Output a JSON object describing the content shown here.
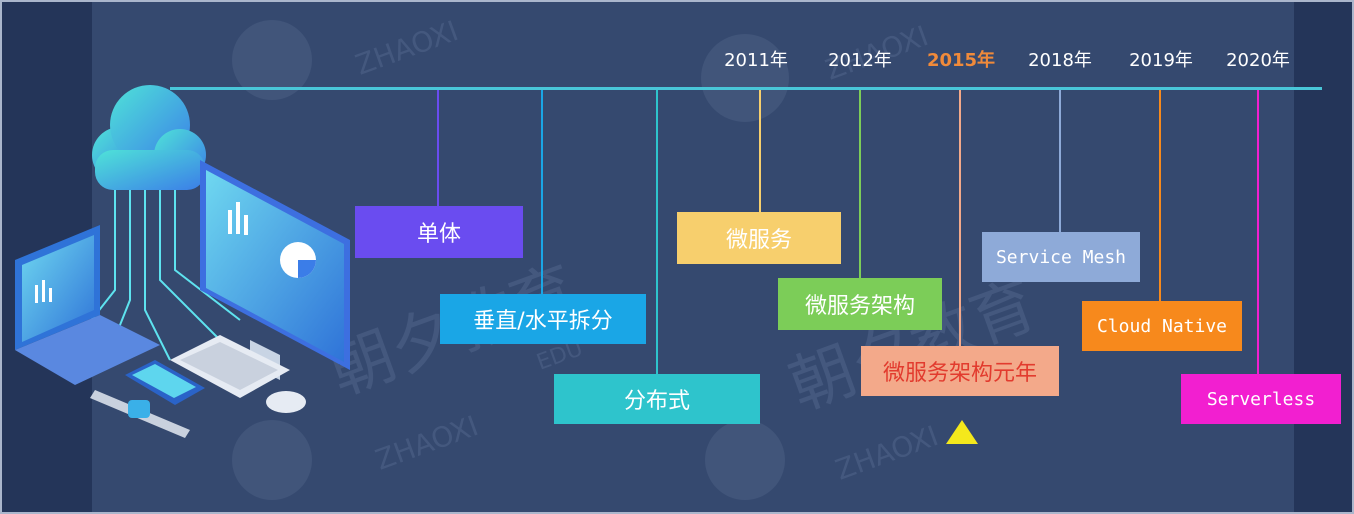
{
  "watermark": {
    "brand": "朝夕教育",
    "latin": "ZHAOXI",
    "edu": "EDU"
  },
  "timeline": {
    "years": [
      {
        "label": "2011年",
        "highlight": false
      },
      {
        "label": "2012年",
        "highlight": false
      },
      {
        "label": "2015年",
        "highlight": true
      },
      {
        "label": "2018年",
        "highlight": false
      },
      {
        "label": "2019年",
        "highlight": false
      },
      {
        "label": "2020年",
        "highlight": false
      }
    ],
    "stages": [
      {
        "label": "单体",
        "color": "#6a4cf0"
      },
      {
        "label": "垂直/水平拆分",
        "color": "#1aa6e6"
      },
      {
        "label": "分布式",
        "color": "#2ec4cc"
      },
      {
        "label": "微服务",
        "color": "#f7cf6d"
      },
      {
        "label": "微服务架构",
        "color": "#7ccd58"
      },
      {
        "label": "微服务架构元年",
        "color": "#f3a98a",
        "text_color": "#e23b2e"
      },
      {
        "label": "Service Mesh",
        "color": "#8eaad8"
      },
      {
        "label": "Cloud Native",
        "color": "#f7891c"
      },
      {
        "label": "Serverless",
        "color": "#f21fd0"
      }
    ],
    "axis_color": "#49c6d8",
    "marker_color": "#f4e81c"
  }
}
